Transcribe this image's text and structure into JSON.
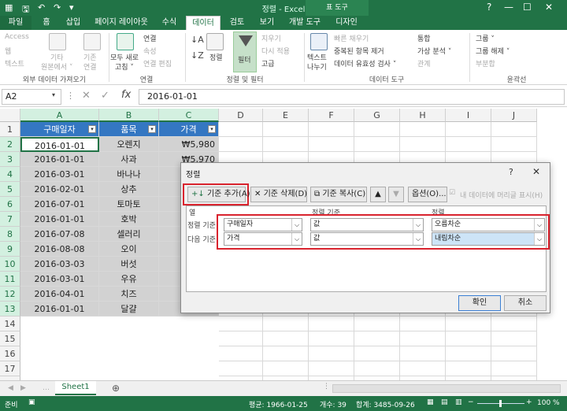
{
  "titlebar": {
    "title": "정렬 - Excel",
    "context_group": "표 도구",
    "save_icon": "save-icon",
    "undo_icon": "undo-icon",
    "redo_icon": "redo-icon"
  },
  "tabs": [
    "파일",
    "홈",
    "삽입",
    "페이지 레이아웃",
    "수식",
    "데이터",
    "검토",
    "보기",
    "개발 도구",
    "디자인"
  ],
  "active_tab": "데이터",
  "ribbon": {
    "external": {
      "access": "Access",
      "web": "웹",
      "text": "텍스트",
      "other_line1": "기타",
      "other_line2": "원본에서 ˅",
      "existing_line1": "기존",
      "existing_line2": "연결",
      "group": "외부 데이터 가져오기"
    },
    "connections": {
      "refresh_line1": "모두 새로",
      "refresh_line2": "고침 ˅",
      "connections": "연결",
      "properties": "속성",
      "edit_links": "연결 편집",
      "group": "연결"
    },
    "sortfilter": {
      "sort": "정렬",
      "filter": "필터",
      "clear": "지우기",
      "reapply": "다시 적용",
      "advanced": "고급",
      "group": "정렬 및 필터"
    },
    "datatools": {
      "text_to_columns_line1": "텍스트",
      "text_to_columns_line2": "나누기",
      "flash_fill": "빠른 채우기",
      "remove_dup": "중복된 항목 제거",
      "validation": "데이터 유효성 검사 ˅",
      "consolidate": "통합",
      "whatif": "가상 분석 ˅",
      "relations": "관계",
      "group": "데이터 도구"
    },
    "outline": {
      "group_btn": "그룹 ˅",
      "ungroup": "그룹 해제 ˅",
      "subtotal": "부분합",
      "group": "윤곽선"
    }
  },
  "formula_bar": {
    "name_box": "A2",
    "formula": "2016-01-01"
  },
  "columns": [
    "A",
    "B",
    "C",
    "D",
    "E",
    "F",
    "G",
    "H",
    "I",
    "J"
  ],
  "rows": [
    "1",
    "2",
    "3",
    "4",
    "5",
    "6",
    "7",
    "8",
    "9",
    "10",
    "11",
    "12",
    "13",
    "14",
    "15",
    "16",
    "17",
    "18"
  ],
  "table": {
    "headers": [
      "구매일자",
      "품목",
      "가격"
    ],
    "rows": [
      [
        "2016-01-01",
        "오렌지",
        "₩5,980"
      ],
      [
        "2016-01-01",
        "사과",
        "₩5,970"
      ],
      [
        "2016-03-01",
        "바나나",
        ""
      ],
      [
        "2016-02-01",
        "상추",
        ""
      ],
      [
        "2016-07-01",
        "토마토",
        ""
      ],
      [
        "2016-01-01",
        "호박",
        ""
      ],
      [
        "2016-07-08",
        "셀러리",
        ""
      ],
      [
        "2016-08-08",
        "오이",
        ""
      ],
      [
        "2016-03-03",
        "버섯",
        ""
      ],
      [
        "2016-03-01",
        "우유",
        ""
      ],
      [
        "2016-04-01",
        "치즈",
        ""
      ],
      [
        "2016-01-01",
        "달걀",
        ""
      ]
    ]
  },
  "dialog": {
    "title": "정렬",
    "help": "?",
    "close": "✕",
    "add_level": "기준 추가(A)",
    "delete_level": "기준 삭제(D)",
    "copy_level": "기준 복사(C)",
    "options": "옵션(O)...",
    "has_headers": "내 데이터에 머리글 표시(H)",
    "col_header": "열",
    "sorton_header": "정렬 기준",
    "order_header": "정렬",
    "levels": [
      {
        "label": "정렬 기준",
        "column": "구매일자",
        "sort_on": "값",
        "order": "오름차순"
      },
      {
        "label": "다음 기준",
        "column": "가격",
        "sort_on": "값",
        "order": "내림차순"
      }
    ],
    "ok": "확인",
    "cancel": "취소"
  },
  "sheet_tabs": [
    "Sheet1"
  ],
  "status": {
    "mode": "준비",
    "average": "평균: 1966-01-25",
    "count": "개수: 39",
    "sum": "합계: 3485-09-26",
    "zoom": "100 %"
  }
}
